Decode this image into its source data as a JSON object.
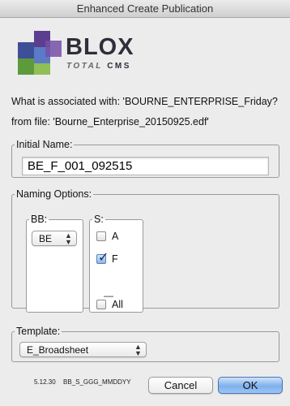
{
  "window": {
    "title": "Enhanced Create Publication"
  },
  "logo": {
    "word": "BLOX",
    "sub_total": "TOTAL",
    "sub_cms": "CMS"
  },
  "info": {
    "associated": "What is associated with: 'BOURNE_ENTERPRISE_Friday?",
    "from_file": "from file: 'Bourne_Enterprise_20150925.edf'"
  },
  "initial_name": {
    "legend": "Initial Name:",
    "value": "BE_F_001_092515"
  },
  "naming_options": {
    "legend": "Naming Options:",
    "bb": {
      "legend": "BB:",
      "selected": "BE"
    },
    "s": {
      "legend": "S:",
      "options": [
        {
          "label": "A",
          "checked": false
        },
        {
          "label": "F",
          "checked": true
        },
        {
          "label": "All",
          "checked": false
        }
      ],
      "separator": "—"
    }
  },
  "template": {
    "legend": "Template:",
    "selected": "E_Broadsheet"
  },
  "footer": {
    "version": "5.12.30",
    "format": "BB_S_GGG_MMDDYY"
  },
  "buttons": {
    "cancel": "Cancel",
    "ok": "OK"
  },
  "colors": {
    "accent": "#7fb0ec",
    "window_bg": "#ececec"
  }
}
